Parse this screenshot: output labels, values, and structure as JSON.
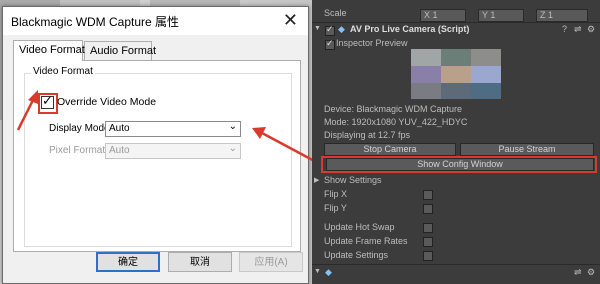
{
  "dialog": {
    "title": "Blackmagic WDM Capture 属性",
    "close_glyph": "✕",
    "tabs": [
      "Video Format",
      "Audio Format"
    ],
    "group_label": "Video Format",
    "override_label": "Override Video Mode",
    "display_mode_label": "Display Mode",
    "display_mode_value": "Auto",
    "pixel_format_label": "Pixel Format",
    "pixel_format_value": "Auto",
    "buttons": {
      "ok": "确定",
      "cancel": "取消",
      "apply": "应用(A)"
    }
  },
  "inspector": {
    "top_row": {
      "label": "Scale",
      "x": "X 1",
      "y": "Y 1",
      "z": "Z 1"
    },
    "header_title": "AV Pro Live Camera (Script)",
    "inspector_preview_label": "Inspector Preview",
    "device": "Device: Blackmagic WDM Capture",
    "mode": "Mode: 1920x1080 YUV_422_HDYC",
    "fps": "Displaying at 12.7 fps",
    "stop_camera": "Stop Camera",
    "pause_stream": "Pause Stream",
    "show_config": "Show Config Window",
    "show_settings": "Show Settings",
    "flip_x": "Flip X",
    "flip_y": "Flip Y",
    "update_hot_swap": "Update Hot Swap",
    "update_frame_rates": "Update Frame Rates",
    "update_settings": "Update Settings"
  },
  "colors": {
    "annotation": "#d93a2b",
    "default_button_border": "#2f6fc7",
    "inspector_bg": "#3c3c3c"
  }
}
